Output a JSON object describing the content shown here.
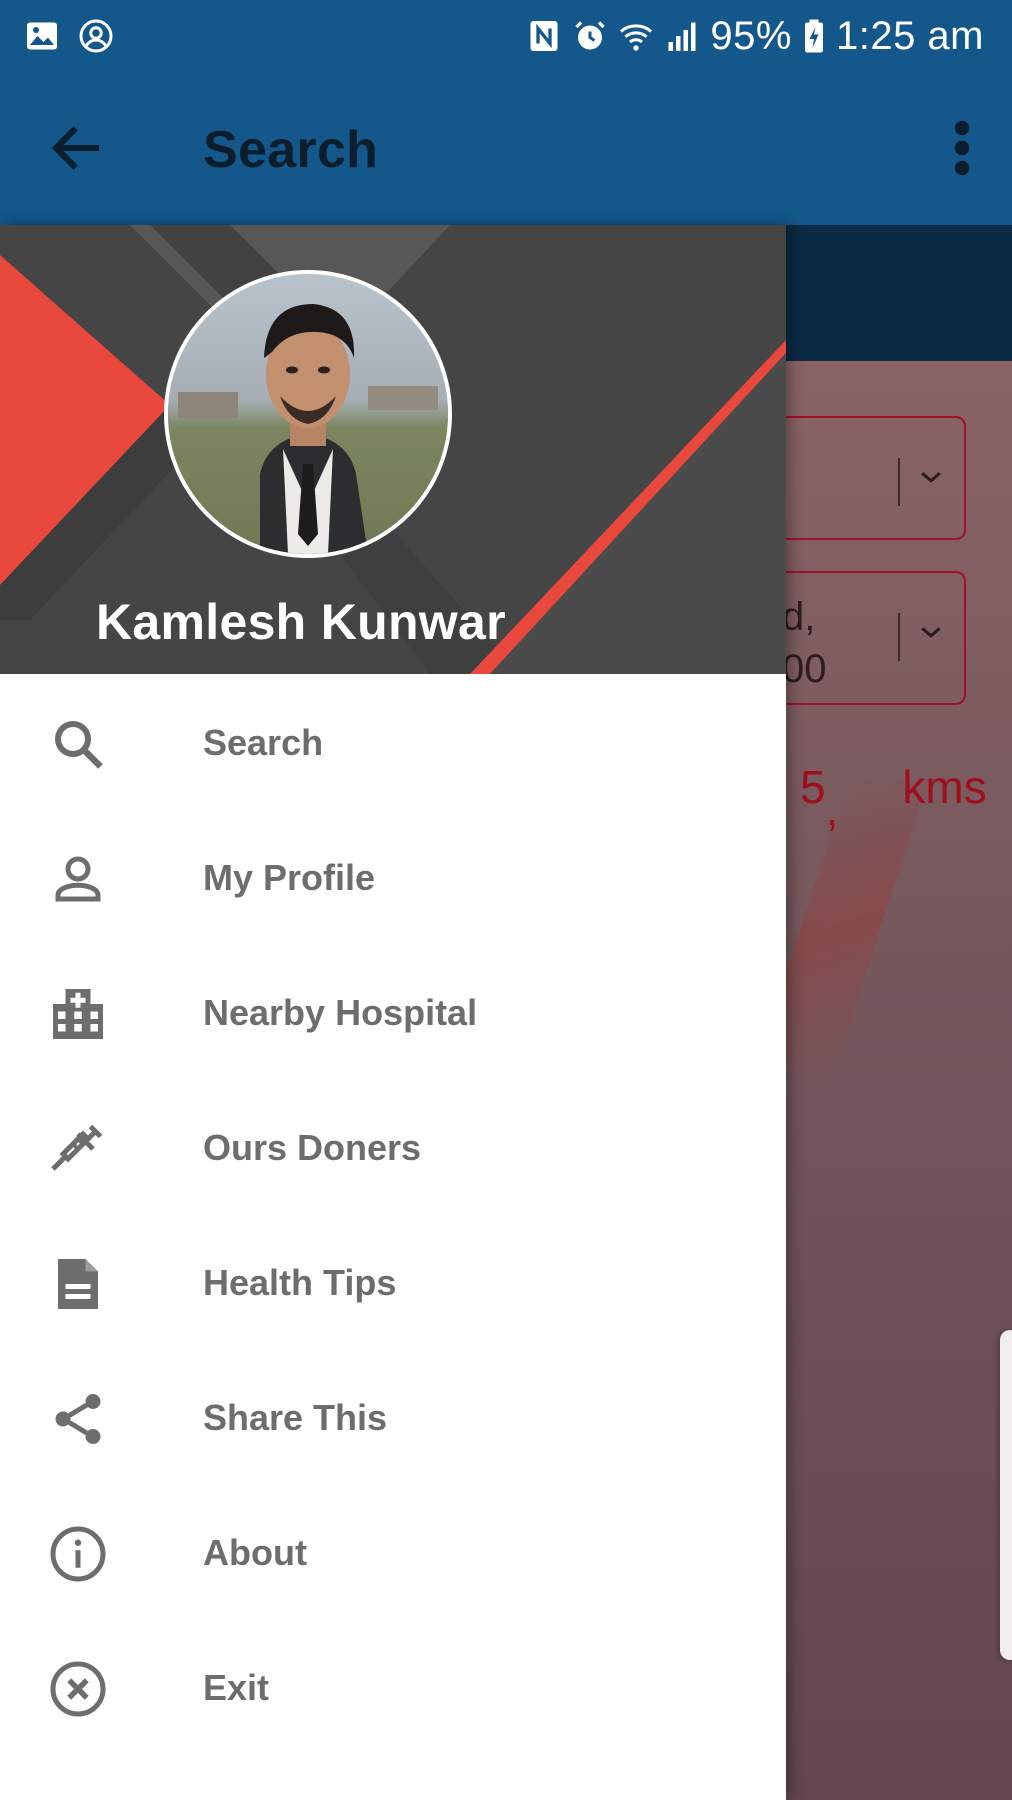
{
  "status_bar": {
    "battery": "95%",
    "time": "1:25 am",
    "icons": [
      "gallery-icon",
      "account-circle-icon",
      "nfc-icon",
      "alarm-icon",
      "wifi-icon",
      "signal-icon",
      "battery-charging-icon"
    ]
  },
  "toolbar": {
    "title": "Search",
    "back_icon": "arrow-back-icon",
    "more_icon": "more-vertical-icon"
  },
  "drawer": {
    "user_name": "Kamlesh Kunwar",
    "items": [
      {
        "label": "Search",
        "icon": "search-icon"
      },
      {
        "label": "My Profile",
        "icon": "person-icon"
      },
      {
        "label": "Nearby Hospital",
        "icon": "hospital-icon"
      },
      {
        "label": "Ours Doners",
        "icon": "syringe-icon"
      },
      {
        "label": "Health Tips",
        "icon": "document-icon"
      },
      {
        "label": "Share This",
        "icon": "share-icon"
      },
      {
        "label": "About",
        "icon": "info-icon"
      },
      {
        "label": "Exit",
        "icon": "close-circle-icon"
      }
    ]
  },
  "background": {
    "dropdown2_text_line1": "d,",
    "dropdown2_text_line2": "00",
    "distance_value": "5",
    "distance_comma": ",",
    "distance_unit": "kms"
  },
  "colors": {
    "primary": "#14578b",
    "header_gray": "#454545",
    "accent_red": "#e8493c",
    "menu_text": "#6d6d6d"
  }
}
